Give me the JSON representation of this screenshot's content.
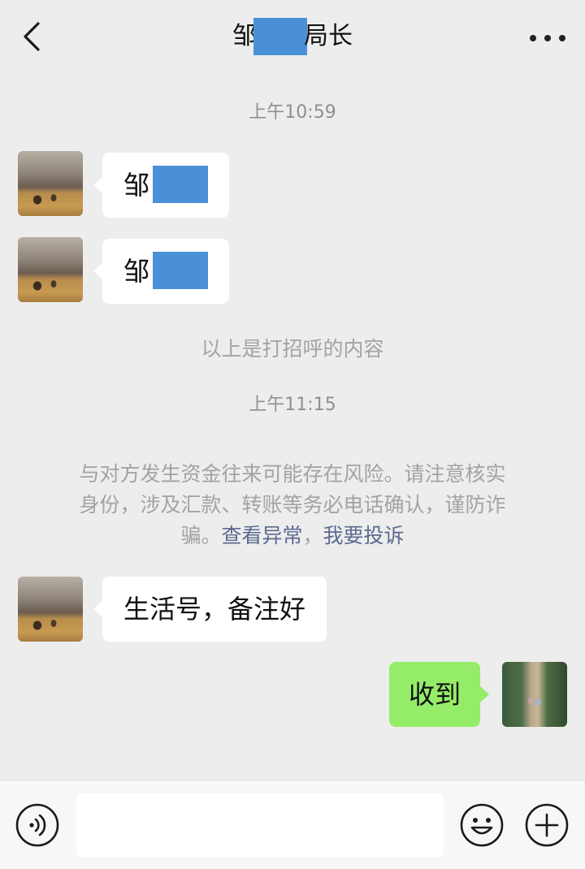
{
  "header": {
    "title_prefix": "邹",
    "title_suffix": "局长"
  },
  "messages": [
    {
      "type": "time",
      "text": "上午10:59"
    },
    {
      "type": "incoming",
      "text": "邹"
    },
    {
      "type": "incoming",
      "text": "邹"
    },
    {
      "type": "system",
      "text": "以上是打招呼的内容"
    },
    {
      "type": "time",
      "text": "上午11:15"
    },
    {
      "type": "notice",
      "lines": [
        "与对方发生资金往来可能存在风险。请注意核实",
        "身份，涉及汇款、转账等务必电话确认，谨防诈"
      ],
      "last_line_prefix": "骗。",
      "link_check": "查看异常",
      "separator": "，",
      "link_report": "我要投诉"
    },
    {
      "type": "incoming",
      "text": "生活号，备注好"
    },
    {
      "type": "outgoing",
      "text": "收到"
    }
  ],
  "input": {
    "value": "",
    "placeholder": ""
  },
  "icons": {
    "back": "chevron-left-icon",
    "more": "more-dots-icon",
    "voice": "voice-icon",
    "emoji": "emoji-icon",
    "plus": "plus-icon"
  },
  "colors": {
    "background": "#ededed",
    "outgoing_bubble": "#95ec69",
    "incoming_bubble": "#ffffff",
    "link": "#5b6a91",
    "redaction": "#4a90d9"
  }
}
